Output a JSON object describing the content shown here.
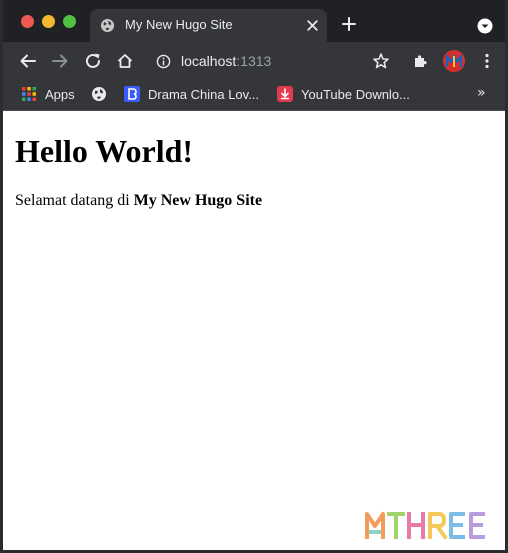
{
  "browser": {
    "tab": {
      "title": "My New Hugo Site",
      "icon": "globe-icon"
    },
    "address_bar": {
      "host": "localhost",
      "port": ":1313"
    },
    "bookmarks": [
      {
        "label": "Apps",
        "icon": "apps-grid-icon"
      },
      {
        "label": "",
        "icon": "globe-icon"
      },
      {
        "label": "Drama China Lov...",
        "icon": "drama-china-favicon"
      },
      {
        "label": "YouTube Downlo...",
        "icon": "youtube-download-favicon"
      }
    ],
    "more_bookmarks": "»"
  },
  "page": {
    "heading": "Hello World!",
    "paragraph_prefix": "Selamat datang di ",
    "paragraph_bold": "My New Hugo Site"
  },
  "watermark": {
    "text": "MTHREE"
  },
  "colors": {
    "chrome_frame": "#202124",
    "chrome_toolbar": "#35363a",
    "text_light": "#e8eaed",
    "text_dim": "#9aa0a6"
  }
}
